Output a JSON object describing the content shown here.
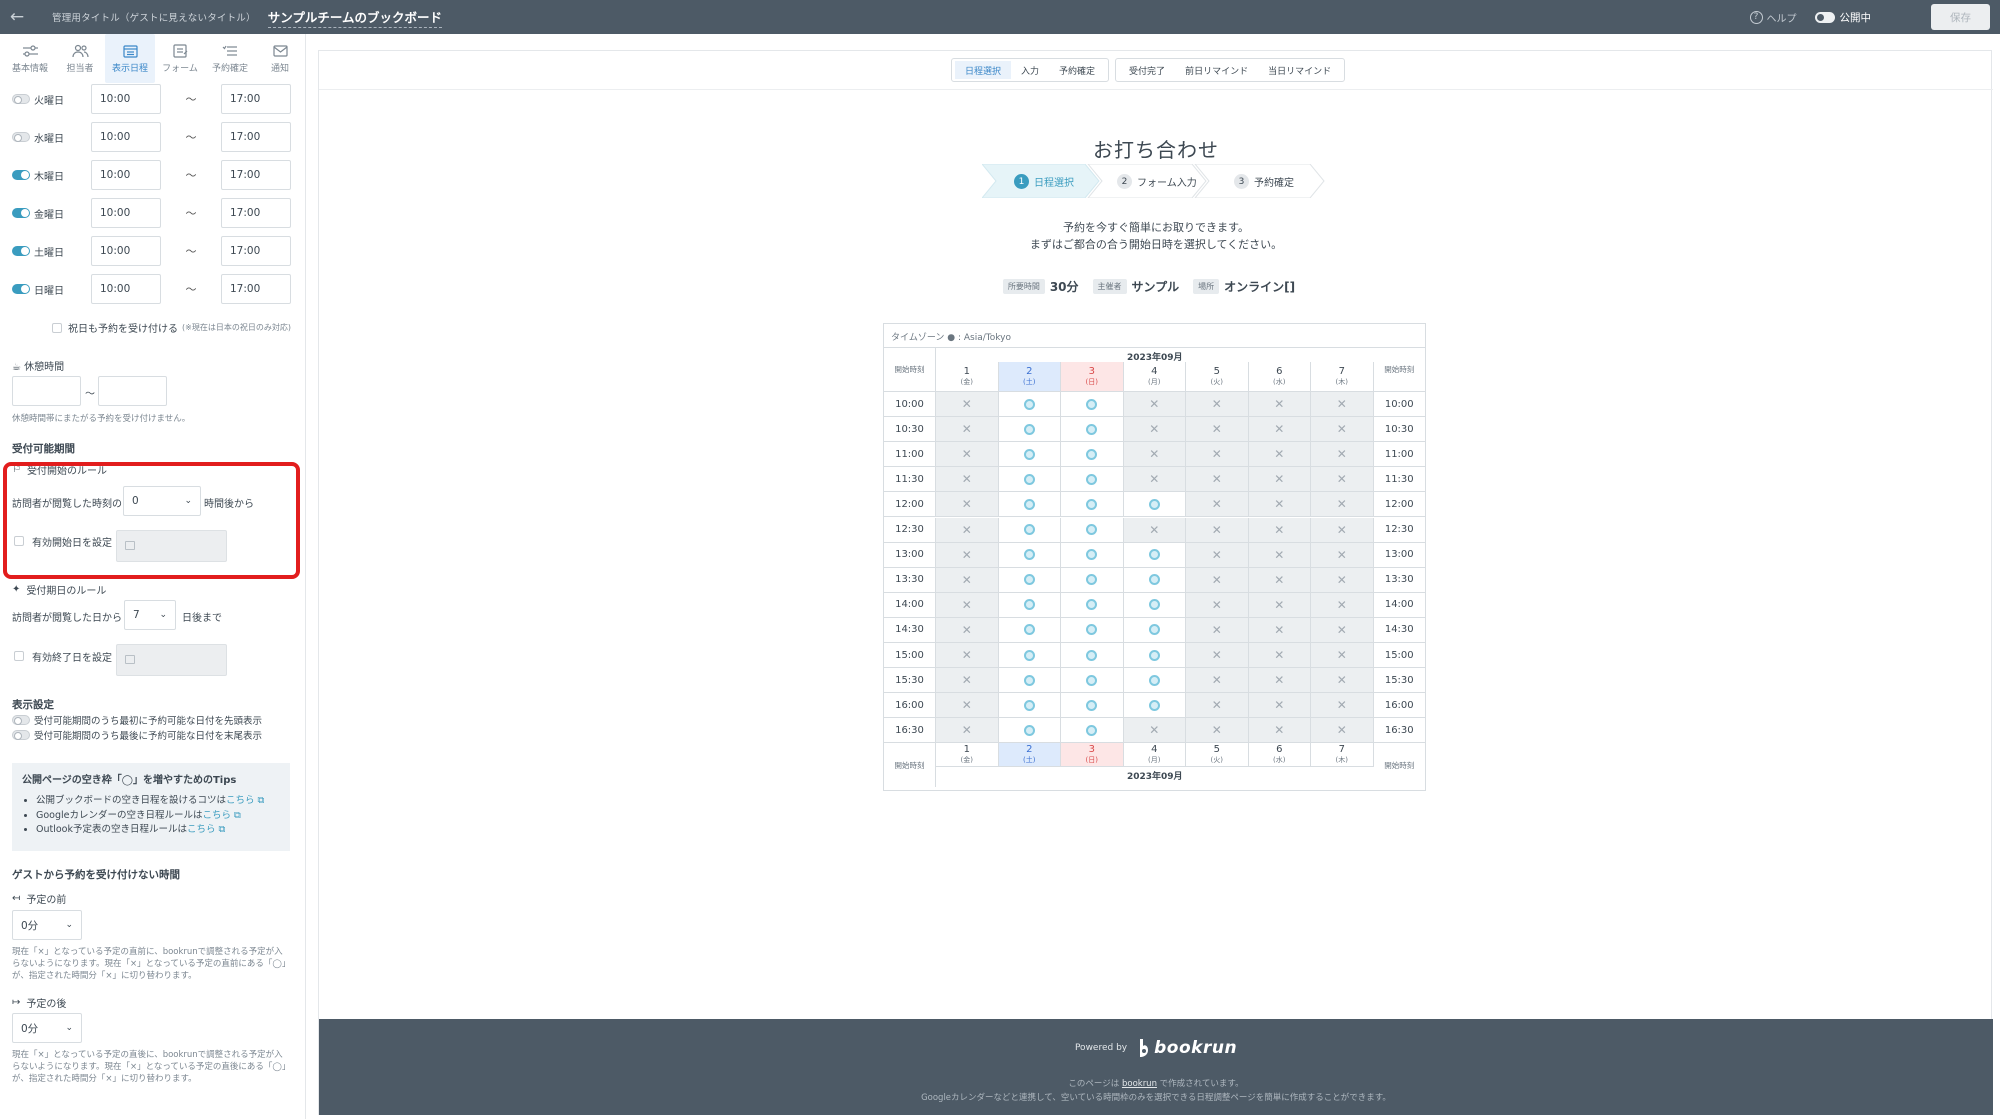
{
  "topbar": {
    "admin_title_label": "管理用タイトル（ゲストに見えないタイトル）",
    "board_title": "サンプルチームのブックボード",
    "help": "ヘルプ",
    "publish_status": "公開中",
    "save": "保存"
  },
  "sidebar": {
    "tabs": [
      {
        "label": "基本情報",
        "icon": "sliders-icon"
      },
      {
        "label": "担当者",
        "icon": "users-icon"
      },
      {
        "label": "表示日程",
        "icon": "calendar-icon"
      },
      {
        "label": "フォーム",
        "icon": "form-icon"
      },
      {
        "label": "予約確定",
        "icon": "confirm-icon"
      },
      {
        "label": "通知",
        "icon": "mail-icon"
      }
    ],
    "days": [
      {
        "label": "火曜日",
        "enabled": false,
        "start": "10:00",
        "end": "17:00"
      },
      {
        "label": "水曜日",
        "enabled": false,
        "start": "10:00",
        "end": "17:00"
      },
      {
        "label": "木曜日",
        "enabled": true,
        "start": "10:00",
        "end": "17:00"
      },
      {
        "label": "金曜日",
        "enabled": true,
        "start": "10:00",
        "end": "17:00"
      },
      {
        "label": "土曜日",
        "enabled": true,
        "start": "10:00",
        "end": "17:00"
      },
      {
        "label": "日曜日",
        "enabled": true,
        "start": "10:00",
        "end": "17:00"
      }
    ],
    "tilde": "〜",
    "holiday_label": "祝日も予約を受け付ける",
    "holiday_note": "(※現在は日本の祝日のみ対応)",
    "break_title": "休憩時間",
    "break_note": "休憩時間帯にまたがる予約を受け付けません。",
    "period_title": "受付可能期間",
    "start_rule_title": "受付開始のルール",
    "start_rule_prefix": "訪問者が閲覧した時刻の",
    "start_rule_value": "0",
    "start_rule_suffix": "時間後から",
    "start_date_label": "有効開始日を設定",
    "end_rule_title": "受付期日のルール",
    "end_rule_prefix": "訪問者が閲覧した日から",
    "end_rule_value": "7",
    "end_rule_suffix": "日後まで",
    "end_date_label": "有効終了日を設定",
    "display_title": "表示設定",
    "display_opt1": "受付可能期間のうち最初に予約可能な日付を先頭表示",
    "display_opt2": "受付可能期間のうち最後に予約可能な日付を末尾表示",
    "tips_title": "公開ページの空き枠「◯」を増やすためのTips",
    "tips": [
      {
        "text": "公開ブックボードの空き日程を設けるコツは",
        "link": "こちら"
      },
      {
        "text": "Googleカレンダーの空き日程ルールは",
        "link": "こちら"
      },
      {
        "text": "Outlook予定表の空き日程ルールは",
        "link": "こちら"
      }
    ],
    "block_title": "ゲストから予約を受け付けない時間",
    "before_label": "予定の前",
    "before_value": "0分",
    "before_note": "現在「×」となっている予定の直前に、bookrunで調整される予定が入らないようになります。現在「×」となっている予定の直前にある「◯」が、指定された時間分「×」に切り替わります。",
    "after_label": "予定の後",
    "after_value": "0分",
    "after_note": "現在「×」となっている予定の直後に、bookrunで調整される予定が入らないようになります。現在「×」となっている予定の直後にある「◯」が、指定された時間分「×」に切り替わります。"
  },
  "preview": {
    "tabs_group1": [
      "日程選択",
      "入力",
      "予約確定"
    ],
    "tabs_group2": [
      "受付完了",
      "前日リマインド",
      "当日リマインド"
    ],
    "title": "お打ち合わせ",
    "steps": [
      "日程選択",
      "フォーム入力",
      "予約確定"
    ],
    "intro_line1": "予約を今すぐ簡単にお取りできます。",
    "intro_line2": "まずはご都合の合う開始日時を選択してください。",
    "meta": [
      {
        "tag": "所要時間",
        "value": "30分"
      },
      {
        "tag": "主催者",
        "value": "サンプル"
      },
      {
        "tag": "場所",
        "value": "オンライン[]"
      }
    ],
    "timezone_label": "タイムゾーン",
    "timezone": "Asia/Tokyo",
    "month": "2023年09月",
    "start_time_label": "開始時刻",
    "dates": [
      {
        "day": "1",
        "weekday": "(金)",
        "type": "weekday"
      },
      {
        "day": "2",
        "weekday": "(土)",
        "type": "sat"
      },
      {
        "day": "3",
        "weekday": "(日)",
        "type": "sun"
      },
      {
        "day": "4",
        "weekday": "(月)",
        "type": "weekday"
      },
      {
        "day": "5",
        "weekday": "(火)",
        "type": "weekday"
      },
      {
        "day": "6",
        "weekday": "(水)",
        "type": "weekday"
      },
      {
        "day": "7",
        "weekday": "(木)",
        "type": "weekday"
      }
    ],
    "times": [
      "10:00",
      "10:30",
      "11:00",
      "11:30",
      "12:00",
      "12:30",
      "13:00",
      "13:30",
      "14:00",
      "14:30",
      "15:00",
      "15:30",
      "16:00",
      "16:30"
    ],
    "availability": [
      "xooxxxx",
      "xooxxxx",
      "xooxxxx",
      "xooxxxx",
      "xoooxxx",
      "xooxxxx",
      "xoooxxx",
      "xoooxxx",
      "xoooxxx",
      "xoooxxx",
      "xoooxxx",
      "xoooxxx",
      "xoooxxx",
      "xooxxxx"
    ],
    "footer_powered": "Powered by",
    "footer_logo": "bookrun",
    "footer_line1_pre": "このページは",
    "footer_line1_link": "bookrun",
    "footer_line1_post": "で作成されています。",
    "footer_line2": "Googleカレンダーなどと連携して、空いている時間枠のみを選択できる日程調整ページを簡単に作成することができます。"
  }
}
